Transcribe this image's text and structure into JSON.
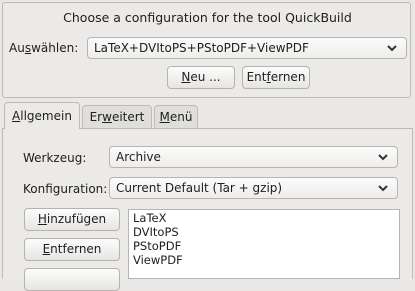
{
  "config": {
    "heading": "Choose a configuration for the tool QuickBuild",
    "select_label_pre": "Au",
    "select_label_mnemonic": "s",
    "select_label_post": "wählen:",
    "selected": "LaTeX+DVItoPS+PStoPDF+ViewPDF",
    "new_button": {
      "pre": "",
      "mnemonic": "N",
      "post": "eu ..."
    },
    "remove_button": {
      "pre": "Ent",
      "mnemonic": "f",
      "post": "ernen"
    }
  },
  "tabs": [
    {
      "pre": "",
      "mnemonic": "A",
      "post": "llgemein"
    },
    {
      "pre": "Er",
      "mnemonic": "w",
      "post": "eitert"
    },
    {
      "pre": "",
      "mnemonic": "M",
      "post": "enü"
    }
  ],
  "general": {
    "tool_label": "Werkzeug:",
    "tool_value": "Archive",
    "config_label": "Konfiguration:",
    "config_value": "Current Default (Tar + gzip)",
    "add_button": {
      "pre": "",
      "mnemonic": "H",
      "post": "inzufügen"
    },
    "remove_button": {
      "pre": "",
      "mnemonic": "E",
      "post": "ntfernen"
    },
    "list_items": [
      "LaTeX",
      "DVItoPS",
      "PStoPDF",
      "ViewPDF"
    ]
  },
  "icons": {
    "dropdown": "chevron-down-icon"
  }
}
